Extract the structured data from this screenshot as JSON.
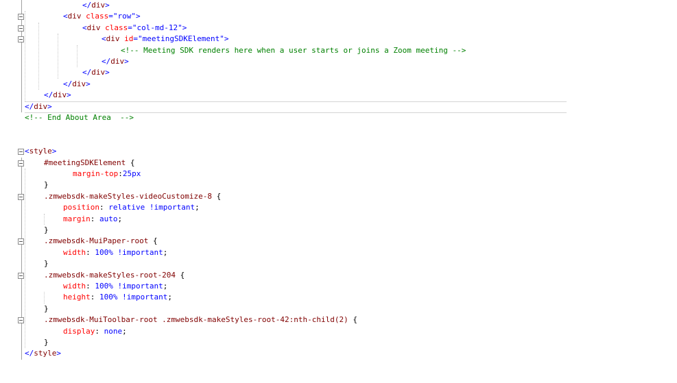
{
  "editor": {
    "lines": [
      {
        "indent": 84,
        "tokens": [
          [
            "t-del",
            "</"
          ],
          [
            "t-tag",
            "div"
          ],
          [
            "t-del",
            ">"
          ]
        ]
      },
      {
        "indent": 56,
        "tokens": [
          [
            "t-del",
            "<"
          ],
          [
            "t-tag",
            "div"
          ],
          [
            "t-txt",
            " "
          ],
          [
            "t-attr",
            "class"
          ],
          [
            "t-del",
            "="
          ],
          [
            "t-val",
            "\"row\""
          ],
          [
            "t-del",
            ">"
          ]
        ]
      },
      {
        "indent": 84,
        "tokens": [
          [
            "t-del",
            "<"
          ],
          [
            "t-tag",
            "div"
          ],
          [
            "t-txt",
            " "
          ],
          [
            "t-attr",
            "class"
          ],
          [
            "t-del",
            "="
          ],
          [
            "t-val",
            "\"col-md-12\""
          ],
          [
            "t-del",
            ">"
          ]
        ]
      },
      {
        "indent": 112,
        "tokens": [
          [
            "t-del",
            "<"
          ],
          [
            "t-tag",
            "div"
          ],
          [
            "t-txt",
            " "
          ],
          [
            "t-attr",
            "id"
          ],
          [
            "t-del",
            "="
          ],
          [
            "t-val",
            "\"meetingSDKElement\""
          ],
          [
            "t-del",
            ">"
          ]
        ]
      },
      {
        "indent": 140,
        "tokens": [
          [
            "t-com",
            "<!-- Meeting SDK renders here when a user starts or joins a Zoom meeting -->"
          ]
        ]
      },
      {
        "indent": 112,
        "tokens": [
          [
            "t-del",
            "</"
          ],
          [
            "t-tag",
            "div"
          ],
          [
            "t-del",
            ">"
          ]
        ]
      },
      {
        "indent": 84,
        "tokens": [
          [
            "t-del",
            "</"
          ],
          [
            "t-tag",
            "div"
          ],
          [
            "t-del",
            ">"
          ]
        ]
      },
      {
        "indent": 56,
        "tokens": [
          [
            "t-del",
            "</"
          ],
          [
            "t-tag",
            "div"
          ],
          [
            "t-del",
            ">"
          ]
        ]
      },
      {
        "indent": 28,
        "tokens": [
          [
            "t-del",
            "</"
          ],
          [
            "t-tag",
            "div"
          ],
          [
            "t-del",
            ">"
          ]
        ]
      },
      {
        "indent": 0,
        "tokens": [
          [
            "t-del",
            "</"
          ],
          [
            "t-tag",
            "div"
          ],
          [
            "t-del",
            ">"
          ]
        ]
      },
      {
        "indent": 0,
        "tokens": [
          [
            "t-com",
            "<!-- End About Area  -->"
          ]
        ]
      },
      {
        "indent": 0,
        "tokens": []
      },
      {
        "indent": 0,
        "tokens": []
      },
      {
        "indent": 0,
        "tokens": [
          [
            "t-del",
            "<"
          ],
          [
            "t-tag",
            "style"
          ],
          [
            "t-del",
            ">"
          ]
        ]
      },
      {
        "indent": 28,
        "tokens": [
          [
            "t-sel",
            "#meetingSDKElement"
          ],
          [
            "t-txt",
            " {"
          ]
        ]
      },
      {
        "indent": 70,
        "tokens": [
          [
            "t-prop",
            "margin-top"
          ],
          [
            "t-txt",
            ":"
          ],
          [
            "t-pval",
            "25px"
          ]
        ]
      },
      {
        "indent": 28,
        "tokens": [
          [
            "t-txt",
            "}"
          ]
        ]
      },
      {
        "indent": 28,
        "tokens": [
          [
            "t-sel",
            ".zmwebsdk-makeStyles-videoCustomize-8"
          ],
          [
            "t-txt",
            " {"
          ]
        ]
      },
      {
        "indent": 56,
        "tokens": [
          [
            "t-prop",
            "position"
          ],
          [
            "t-txt",
            ": "
          ],
          [
            "t-pval",
            "relative !important"
          ],
          [
            "t-txt",
            ";"
          ]
        ]
      },
      {
        "indent": 56,
        "tokens": [
          [
            "t-prop",
            "margin"
          ],
          [
            "t-txt",
            ": "
          ],
          [
            "t-pval",
            "auto"
          ],
          [
            "t-txt",
            ";"
          ]
        ]
      },
      {
        "indent": 28,
        "tokens": [
          [
            "t-txt",
            "}"
          ]
        ]
      },
      {
        "indent": 28,
        "tokens": [
          [
            "t-sel",
            ".zmwebsdk-MuiPaper-root"
          ],
          [
            "t-txt",
            " {"
          ]
        ]
      },
      {
        "indent": 56,
        "tokens": [
          [
            "t-prop",
            "width"
          ],
          [
            "t-txt",
            ": "
          ],
          [
            "t-pval",
            "100% !important"
          ],
          [
            "t-txt",
            ";"
          ]
        ]
      },
      {
        "indent": 28,
        "tokens": [
          [
            "t-txt",
            "}"
          ]
        ]
      },
      {
        "indent": 28,
        "tokens": [
          [
            "t-sel",
            ".zmwebsdk-makeStyles-root-204"
          ],
          [
            "t-txt",
            " {"
          ]
        ]
      },
      {
        "indent": 56,
        "tokens": [
          [
            "t-prop",
            "width"
          ],
          [
            "t-txt",
            ": "
          ],
          [
            "t-pval",
            "100% !important"
          ],
          [
            "t-txt",
            ";"
          ]
        ]
      },
      {
        "indent": 56,
        "tokens": [
          [
            "t-prop",
            "height"
          ],
          [
            "t-txt",
            ": "
          ],
          [
            "t-pval",
            "100% !important"
          ],
          [
            "t-txt",
            ";"
          ]
        ]
      },
      {
        "indent": 28,
        "tokens": [
          [
            "t-txt",
            "}"
          ]
        ]
      },
      {
        "indent": 28,
        "tokens": [
          [
            "t-sel",
            ".zmwebsdk-MuiToolbar-root .zmwebsdk-makeStyles-root-42:nth-child(2)"
          ],
          [
            "t-txt",
            " {"
          ]
        ]
      },
      {
        "indent": 56,
        "tokens": [
          [
            "t-prop",
            "display"
          ],
          [
            "t-txt",
            ": "
          ],
          [
            "t-pval",
            "none"
          ],
          [
            "t-txt",
            ";"
          ]
        ]
      },
      {
        "indent": 28,
        "tokens": [
          [
            "t-txt",
            "}"
          ]
        ]
      },
      {
        "indent": 0,
        "tokens": [
          [
            "t-del",
            "</"
          ],
          [
            "t-tag",
            "style"
          ],
          [
            "t-del",
            ">"
          ]
        ]
      }
    ],
    "fold_markers": [
      1,
      2,
      3,
      13,
      14,
      17,
      21,
      24,
      28
    ],
    "guides": [
      [
        0,
        9,
        36
      ],
      [
        1,
        8,
        56
      ],
      [
        2,
        7,
        84
      ],
      [
        3,
        6,
        112
      ],
      [
        14,
        31,
        36
      ],
      [
        15,
        16,
        64
      ],
      [
        18,
        20,
        64
      ],
      [
        22,
        23,
        64
      ],
      [
        25,
        27,
        64
      ],
      [
        29,
        30,
        64
      ]
    ],
    "gutter_bars": [
      [
        0,
        10
      ],
      [
        14,
        32
      ]
    ],
    "separators": [
      9,
      10
    ]
  }
}
